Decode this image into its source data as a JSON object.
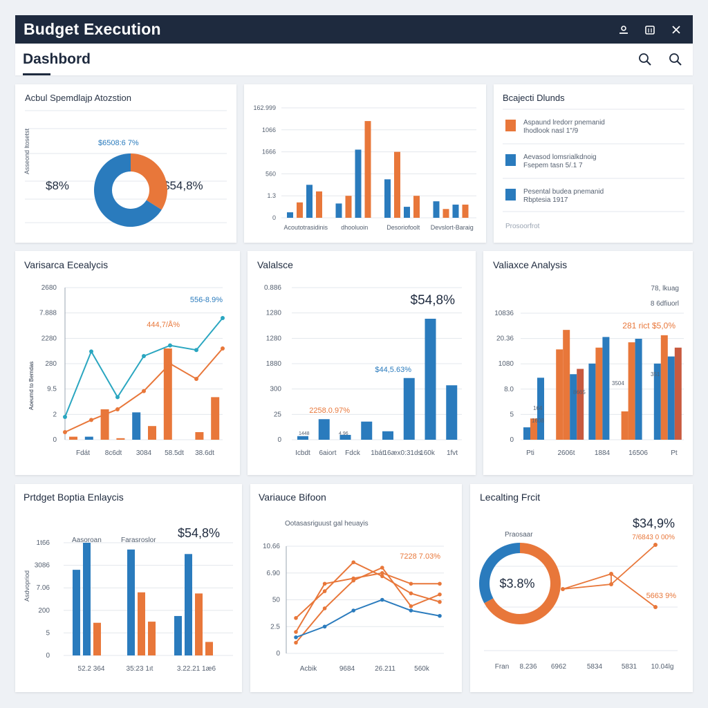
{
  "window": {
    "title": "Budget Execution"
  },
  "subheader": {
    "tab": "Dashbord"
  },
  "colors": {
    "blue": "#2a7bbd",
    "orange": "#e8773a",
    "teal": "#2aa6c0",
    "navy": "#1e2a3e",
    "red": "#c85a3f"
  },
  "panels": {
    "p1": {
      "title": "Acbul Spemdlajp Atozstion",
      "yaxis": "Asseond ltosetst",
      "top_label": "$6508:6 7%",
      "left_value": "$8%",
      "right_value": "$54,8%",
      "chart_data": {
        "type": "pie",
        "values": [
          34,
          66
        ],
        "colors": [
          "#e8773a",
          "#2a7bbd"
        ]
      }
    },
    "p2": {
      "chart_data": {
        "type": "bar",
        "y_ticks": [
          "162.999",
          "1066",
          "1666",
          "560",
          "1.3",
          "0"
        ],
        "groups": [
          "Acoutotrasidinis",
          "dhooluoin",
          "Desoriofoolt",
          "Devslort-Baraig"
        ],
        "series": [
          {
            "values": [
              5,
              13,
              35,
              15
            ],
            "color": "#2a7bbd"
          },
          {
            "values": [
              14,
              20,
              60,
              8
            ],
            "color": "#e8773a"
          },
          {
            "values": [
              30,
              62,
              10,
              12
            ],
            "color": "#2a7bbd"
          },
          {
            "values": [
              24,
              88,
              20,
              12
            ],
            "color": "#e8773a"
          }
        ],
        "ylim": [
          0,
          100
        ]
      }
    },
    "p3": {
      "title": "Bcajecti Dlunds",
      "items": [
        {
          "text1": "Aspaund lredorr pnemanid",
          "text2": "Ihodlook nasl 1\"/9",
          "color": "#e8773a"
        },
        {
          "text1": "Aevasod lomsrialkdnoig",
          "text2": "Fsepem tasn 5/.1 7",
          "color": "#2a7bbd"
        },
        {
          "text1": "Pesental budea pnemanid",
          "text2": "Rbptesia 1917",
          "color": "#2a7bbd"
        }
      ],
      "footer": "Prosoorfrot"
    },
    "p4": {
      "title": "Varisarca Ecealycis",
      "yaxis": "Aoeumd to Bemdas",
      "y_ticks": [
        "2680",
        "7.888",
        "2280",
        "280",
        "9.5",
        "2",
        "0"
      ],
      "x_ticks": [
        "Fdát",
        "8c6dt",
        "3084",
        "58.5dt",
        "38.6dt"
      ],
      "ann1": "556-8.9%",
      "ann2": "444,7/Å%",
      "chart_data": {
        "type": "line",
        "series": [
          {
            "values": [
              15,
              58,
              28,
              55,
              62,
              59,
              80
            ],
            "color": "#2aa6c0"
          },
          {
            "values": [
              5,
              13,
              20,
              32,
              50,
              40,
              60
            ],
            "color": "#e8773a"
          }
        ],
        "bars": [
          2,
          2,
          20,
          1,
          18,
          9,
          60,
          0,
          5,
          28
        ],
        "ylim": [
          0,
          100
        ]
      }
    },
    "p5": {
      "title": "Valalsce",
      "y_ticks": [
        "0.886",
        "1280",
        "1280",
        "1880",
        "300",
        "25",
        "0"
      ],
      "x_ticks": [
        "Icbdt",
        "6aiort",
        "Fdck",
        "1bát",
        "16æx0:31ds",
        "160k",
        "1fvt"
      ],
      "big_value": "$54,8%",
      "ann1": "$44,5.63%",
      "ann2": "2258.0.97%",
      "mini_labels": [
        "1448",
        "4.96"
      ],
      "chart_data": {
        "type": "bar",
        "values": [
          3,
          17,
          4,
          15,
          7,
          51,
          100,
          45
        ],
        "ylim": [
          0,
          100
        ]
      }
    },
    "p6": {
      "title": "Valiaxce Analysis",
      "y_ticks": [
        "10836",
        "20.36",
        "1080",
        "8.0",
        "5",
        "0"
      ],
      "x_ticks": [
        "Pti",
        "2606t",
        "1884",
        "16506",
        "Pt"
      ],
      "legend1": "78, lkuag",
      "legend2": "8 6dfiuorl",
      "ann_orange": "281 rict  $5,0%",
      "bar_labels": [
        "1608",
        "8665",
        "3504",
        "351",
        "164"
      ],
      "chart_data": {
        "type": "bar",
        "groups": [
          [
            7,
            12,
            35,
            0
          ],
          [
            51,
            62,
            37,
            40
          ],
          [
            43,
            52,
            58,
            0
          ],
          [
            16,
            55,
            57,
            0
          ],
          [
            43,
            59,
            47,
            52
          ]
        ],
        "ylim": [
          0,
          100
        ]
      }
    },
    "p7": {
      "title": "Prtdget Boptia Enlaycis",
      "yaxis": "Asdvopriod",
      "y_ticks": [
        "1t66",
        "3086",
        "7.06",
        "200",
        "5",
        "0"
      ],
      "x_ticks": [
        "52.2 364",
        "35:23 1ıt",
        "3.22.21 1æ6"
      ],
      "legend_a": "Aasoroan",
      "legend_b": "Farasroslor",
      "big_value": "$54,8%",
      "chart_data": {
        "type": "bar",
        "groups": [
          {
            "values": [
              76,
              100,
              29
            ],
            "colors": [
              "#2a7bbd",
              "#2a7bbd",
              "#e8773a"
            ]
          },
          {
            "values": [
              94,
              56,
              30
            ],
            "colors": [
              "#2a7bbd",
              "#e8773a",
              "#e8773a"
            ]
          },
          {
            "values": [
              35,
              90,
              55,
              12
            ],
            "colors": [
              "#2a7bbd",
              "#2a7bbd",
              "#e8773a",
              "#e8773a"
            ]
          }
        ],
        "ylim": [
          0,
          100
        ]
      }
    },
    "p8": {
      "title": "Variauce Bifoon",
      "subtitle": "Ootasasriguust gal heuayis",
      "y_ticks": [
        "10.66",
        "6.90",
        "50",
        "2.5",
        "0"
      ],
      "x_ticks": [
        "Acbik",
        "9684",
        "26.211",
        "560k"
      ],
      "ann": "7228 7.03%",
      "chart_data": {
        "type": "line",
        "series": [
          {
            "values": [
              20,
              65,
              70,
              75,
              65,
              65
            ],
            "color": "#e8773a"
          },
          {
            "values": [
              33,
              58,
              85,
              72,
              56,
              48
            ],
            "color": "#e8773a"
          },
          {
            "values": [
              10,
              42,
              68,
              80,
              44,
              55
            ],
            "color": "#e8773a"
          },
          {
            "values": [
              15,
              25,
              40,
              50,
              40,
              35
            ],
            "color": "#2a7bbd"
          }
        ],
        "ylim": [
          0,
          100
        ]
      }
    },
    "p9": {
      "title": "Lecalting Frcit",
      "sub": "Praosaar",
      "big_value": "$34,9%",
      "sub_value": "7/6843 0 00%",
      "donut_value": "$3.8%",
      "ann": "5663 9%",
      "x_ticks": [
        "Fran",
        "8.236",
        "6962",
        "5834",
        "5831",
        "10.04lg"
      ],
      "chart_data": {
        "type": "pie",
        "values": [
          67,
          33
        ],
        "colors": [
          "#e8773a",
          "#2a7bbd"
        ],
        "line": [
          50,
          55,
          78,
          57,
          97
        ]
      }
    }
  }
}
